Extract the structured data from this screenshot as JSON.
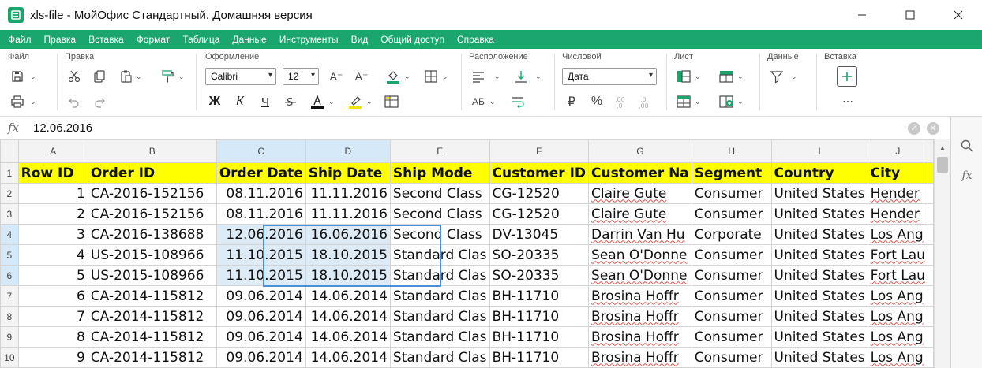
{
  "window": {
    "title": "xls-file - МойОфис Стандартный. Домашняя версия"
  },
  "menu": [
    "Файл",
    "Правка",
    "Вставка",
    "Формат",
    "Таблица",
    "Данные",
    "Инструменты",
    "Вид",
    "Общий доступ",
    "Справка"
  ],
  "ribbon": {
    "groups": {
      "file": "Файл",
      "edit": "Правка",
      "format": "Оформление",
      "layout": "Расположение",
      "number": "Числовой",
      "sheet": "Лист",
      "data": "Данные",
      "insert": "Вставка"
    },
    "font_name": "Calibri",
    "font_size": "12",
    "number_format": "Дата",
    "bold": "Ж",
    "italic": "К",
    "underline": "Ч",
    "currency": "₽",
    "percent": "%"
  },
  "formula_bar": {
    "fx": "fx",
    "content": "12.06.2016"
  },
  "colors": {
    "accent": "#1aa66d",
    "header_fill": "#ffff00",
    "selection": "#ddebf7"
  },
  "grid": {
    "columns": [
      "A",
      "B",
      "C",
      "D",
      "E",
      "F",
      "G",
      "H",
      "I",
      "J"
    ],
    "row_numbers": [
      "1",
      "2",
      "3",
      "4",
      "5",
      "6",
      "7",
      "8",
      "9",
      "10"
    ],
    "header": [
      "Row ID",
      "Order ID",
      "Order Date",
      "Ship Date",
      "Ship Mode",
      "Customer ID",
      "Customer Na",
      "Segment",
      "Country",
      "City"
    ],
    "rows": [
      [
        "1",
        "CA-2016-152156",
        "08.11.2016",
        "11.11.2016",
        "Second Class",
        "CG-12520",
        "Claire Gute",
        "Consumer",
        "United States",
        "Hender"
      ],
      [
        "2",
        "CA-2016-152156",
        "08.11.2016",
        "11.11.2016",
        "Second Class",
        "CG-12520",
        "Claire Gute",
        "Consumer",
        "United States",
        "Hender"
      ],
      [
        "3",
        "CA-2016-138688",
        "12.06.2016",
        "16.06.2016",
        "Second Class",
        "DV-13045",
        "Darrin Van Hu",
        "Corporate",
        "United States",
        "Los Ang"
      ],
      [
        "4",
        "US-2015-108966",
        "11.10.2015",
        "18.10.2015",
        "Standard Clas",
        "SO-20335",
        "Sean O'Donne",
        "Consumer",
        "United States",
        "Fort Lau"
      ],
      [
        "5",
        "US-2015-108966",
        "11.10.2015",
        "18.10.2015",
        "Standard Clas",
        "SO-20335",
        "Sean O'Donne",
        "Consumer",
        "United States",
        "Fort Lau"
      ],
      [
        "6",
        "CA-2014-115812",
        "09.06.2014",
        "14.06.2014",
        "Standard Clas",
        "BH-11710",
        "Brosina Hoffr",
        "Consumer",
        "United States",
        "Los Ang"
      ],
      [
        "7",
        "CA-2014-115812",
        "09.06.2014",
        "14.06.2014",
        "Standard Clas",
        "BH-11710",
        "Brosina Hoffr",
        "Consumer",
        "United States",
        "Los Ang"
      ],
      [
        "8",
        "CA-2014-115812",
        "09.06.2014",
        "14.06.2014",
        "Standard Clas",
        "BH-11710",
        "Brosina Hoffr",
        "Consumer",
        "United States",
        "Los Ang"
      ],
      [
        "9",
        "CA-2014-115812",
        "09.06.2014",
        "14.06.2014",
        "Standard Clas",
        "BH-11710",
        "Brosina Hoffr",
        "Consumer",
        "United States",
        "Los Ang"
      ]
    ]
  }
}
